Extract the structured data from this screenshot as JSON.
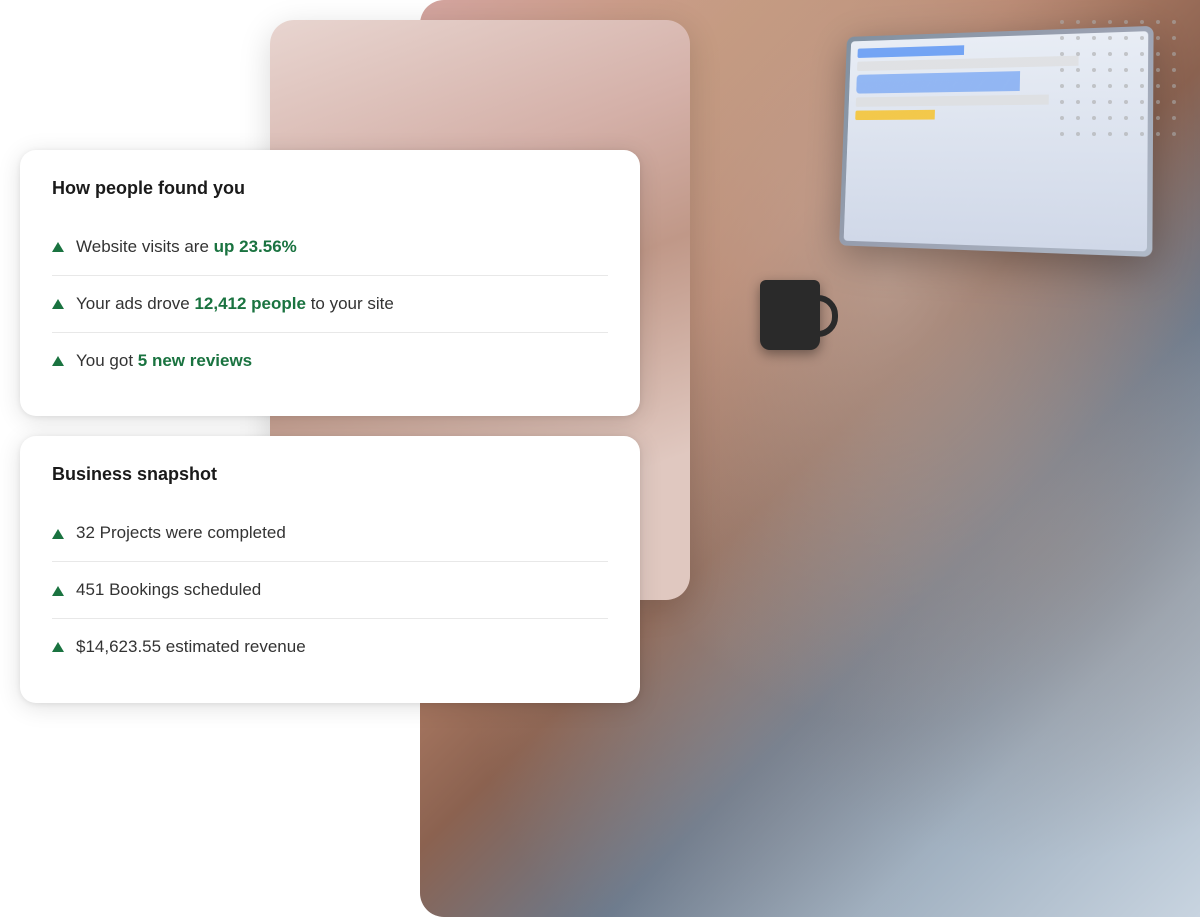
{
  "scene": {
    "dots_count": 64
  },
  "card_found": {
    "title": "How people found you",
    "items": [
      {
        "id": "website-visits",
        "prefix": "Website visits are ",
        "highlight": "up 23.56%",
        "suffix": ""
      },
      {
        "id": "ads-drove",
        "prefix": "Your ads drove ",
        "highlight": "12,412 people",
        "suffix": " to your site"
      },
      {
        "id": "new-reviews",
        "prefix": "You got ",
        "highlight": "5 new reviews",
        "suffix": ""
      }
    ]
  },
  "card_snapshot": {
    "title": "Business snapshot",
    "items": [
      {
        "id": "projects-completed",
        "prefix": "32 Projects were completed",
        "highlight": "",
        "suffix": ""
      },
      {
        "id": "bookings-scheduled",
        "prefix": "451 Bookings scheduled",
        "highlight": "",
        "suffix": ""
      },
      {
        "id": "estimated-revenue",
        "prefix": "$14,623.55 estimated revenue",
        "highlight": "",
        "suffix": ""
      }
    ]
  }
}
